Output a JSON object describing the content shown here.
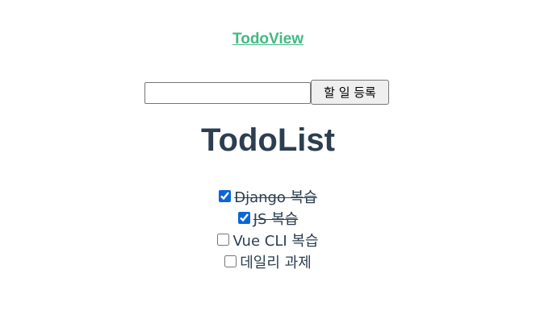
{
  "nav": {
    "link_label": "TodoView"
  },
  "form": {
    "input_value": "",
    "submit_label": "할 일 등록"
  },
  "list": {
    "title": "TodoList",
    "items": [
      {
        "label": "Django 복습",
        "completed": true
      },
      {
        "label": "JS 복습",
        "completed": true
      },
      {
        "label": "Vue CLI 복습",
        "completed": false
      },
      {
        "label": "데일리 과제",
        "completed": false
      }
    ]
  },
  "colors": {
    "accent": "#42b983",
    "text": "#2c3e50",
    "checkbox": "#0a66d8"
  }
}
